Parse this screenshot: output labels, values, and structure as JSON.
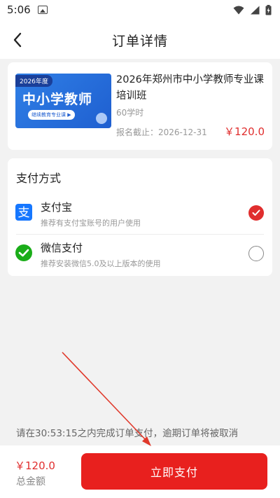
{
  "status_bar": {
    "time": "5:06"
  },
  "header": {
    "title": "订单详情"
  },
  "order": {
    "thumb_year": "2026年度",
    "thumb_title": "中小学教师",
    "thumb_tag": "继续教育专业课 ▶",
    "course_name": "2026年郑州市中小学教师专业课培训班",
    "hours": "60学时",
    "deadline": "报名截止：2026-12-31",
    "price": "￥120.0"
  },
  "payment": {
    "title": "支付方式",
    "options": [
      {
        "name": "支付宝",
        "desc": "推荐有支付宝账号的用户使用",
        "icon": "alipay-icon",
        "selected": true
      },
      {
        "name": "微信支付",
        "desc": "推荐安装微信5.0及以上版本的使用",
        "icon": "wechat-pay-icon",
        "selected": false
      }
    ]
  },
  "notice": "请在30:53:15之内完成订单支付，逾期订单将被取消",
  "footer": {
    "total_price": "￥120.0",
    "total_label": "总金额",
    "pay_button_label": "立即支付"
  },
  "colors": {
    "accent": "#e8201e",
    "price": "#e02e2e",
    "alipay": "#1677ff",
    "wechat": "#1aad19"
  }
}
